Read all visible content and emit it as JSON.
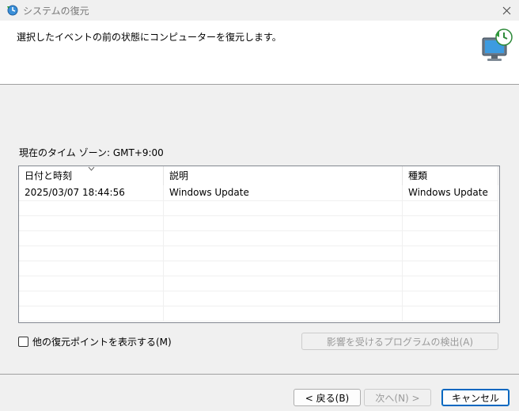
{
  "window": {
    "title": "システムの復元",
    "icon": "system-restore-icon",
    "close_icon": "close-icon"
  },
  "header": {
    "instruction": "選択したイベントの前の状態にコンピューターを復元します。",
    "icon": "monitor-restore-icon"
  },
  "timezone_label": "現在のタイム ゾーン: GMT+9:00",
  "table": {
    "columns": [
      "日付と時刻",
      "説明",
      "種類"
    ],
    "sorted_column": 0,
    "rows": [
      [
        "2025/03/07 18:44:56",
        "Windows Update",
        "Windows Update"
      ]
    ]
  },
  "show_more_checkbox": {
    "label": "他の復元ポイントを表示する(M)",
    "checked": false
  },
  "scan_button": {
    "label": "影響を受けるプログラムの検出(A)",
    "enabled": false
  },
  "footer": {
    "back_label": "< 戻る(B)",
    "next_label": "次へ(N) >",
    "cancel_label": "キャンセル"
  },
  "colors": {
    "background": "#f0f0f0",
    "header_background": "#ffffff",
    "default_button_border": "#0067c0",
    "disabled_text": "#9a9a9a"
  }
}
